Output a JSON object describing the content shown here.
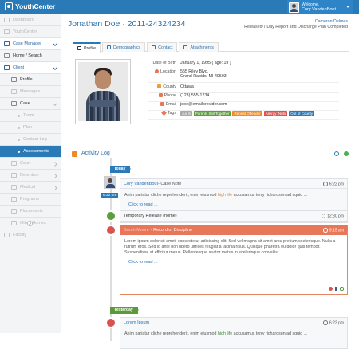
{
  "app": {
    "brand": "YouthCenter"
  },
  "user": {
    "greeting": "Welcome,",
    "name": "Cory VandenBout"
  },
  "sidebar": {
    "items": [
      {
        "label": "Dashboard",
        "state": "disabled"
      },
      {
        "label": "YouthCenter",
        "state": "disabled"
      },
      {
        "label": "Case Manager",
        "state": "active"
      },
      {
        "label": "Home / Search",
        "state": "normal"
      },
      {
        "label": "Client",
        "state": "active-sub"
      },
      {
        "label": "Profile",
        "state": "normal"
      },
      {
        "label": "Messages",
        "state": "disabled"
      },
      {
        "label": "Case",
        "state": "normal"
      },
      {
        "label": "Team",
        "state": "disabled"
      },
      {
        "label": "Plan",
        "state": "disabled"
      },
      {
        "label": "Contact Log",
        "state": "disabled"
      },
      {
        "label": "Assessments",
        "state": "selected"
      },
      {
        "label": "Court",
        "state": "disabled"
      },
      {
        "label": "Detention",
        "state": "disabled"
      },
      {
        "label": "Medical",
        "state": "disabled"
      },
      {
        "label": "Programs",
        "state": "disabled"
      },
      {
        "label": "Placements",
        "state": "disabled"
      },
      {
        "label": "Other Homes",
        "state": "disabled"
      },
      {
        "label": "Facility",
        "state": "disabled"
      }
    ]
  },
  "header": {
    "title": "Jonathan Doe · 2011-24324234",
    "right_name": "Cameron Delmes",
    "right_status": "Released/7 Day Report and Discharge Plan Completed"
  },
  "tabs": [
    {
      "label": "Profile",
      "active": true
    },
    {
      "label": "Demographics",
      "active": false
    },
    {
      "label": "Contact",
      "active": false
    },
    {
      "label": "Attachments",
      "active": false
    }
  ],
  "profile": {
    "dob_label": "Date of Birth",
    "dob": "January 1, 1995 ( age: 19 )",
    "location_label": "Location",
    "location_line1": "555 Riley Blvd.",
    "location_line2": "Grand Rapids, MI 49503",
    "county_label": "County",
    "county": "Ottawa",
    "phone_label": "Phone",
    "phone": "(123) 555-1234",
    "email_label": "Email",
    "email": "jdoe@emailprovider.com",
    "tags_label": "Tags",
    "tags": [
      {
        "label": "Juv 6",
        "color": "#aaaaaa"
      },
      {
        "label": "Parents Still Together",
        "color": "#5b9e3c"
      },
      {
        "label": "Repeat Offender",
        "color": "#f08a24"
      },
      {
        "label": "Allergy: Nuts",
        "color": "#d9534f"
      },
      {
        "label": "Out of County",
        "color": "#2a7ab8"
      }
    ]
  },
  "activity": {
    "title": "Activity Log",
    "day_today": "Today",
    "day_yesterday": "Yesterday",
    "entries": [
      {
        "author": "Cory VandenBout",
        "kind": " - Case Note",
        "time": "6:22 pm",
        "badge_time": "6:22 pm",
        "body_a": "Anim pariatur cliche reprehenderit, enim eiusmod ",
        "body_hl": "high life",
        "body_b": " accusamus terry richardson ad squid ...",
        "more": "Click to read ..."
      },
      {
        "title": "Temporary Release (home)",
        "time": "12:30 pm"
      },
      {
        "author": "Sarah Moore",
        "kind": " - Record of Discipline",
        "time": "9:15 am",
        "body": "Lorem ipsum dolor sit amet, consectetur adipiscing elit. Sed vel magna sit amet arcu pretium scelerisque. Nulla a rutrum eros. Sed id ante non libero ultrices feugiat a lacinia risus. Quisque pharetra eu dolor quis tempor. Suspendisse at efficitur metus. Pellentesque auctor metus in scelerisque convallis.",
        "more": "Click to read ..."
      },
      {
        "title": "Lorem Ipsum",
        "time": "6:22 pm",
        "body_a": "Anim pariatur cliche reprehenderit, enim eiusmod ",
        "body_hl": "high life",
        "body_b": " accusamus terry richardson ad squid ..."
      }
    ]
  }
}
